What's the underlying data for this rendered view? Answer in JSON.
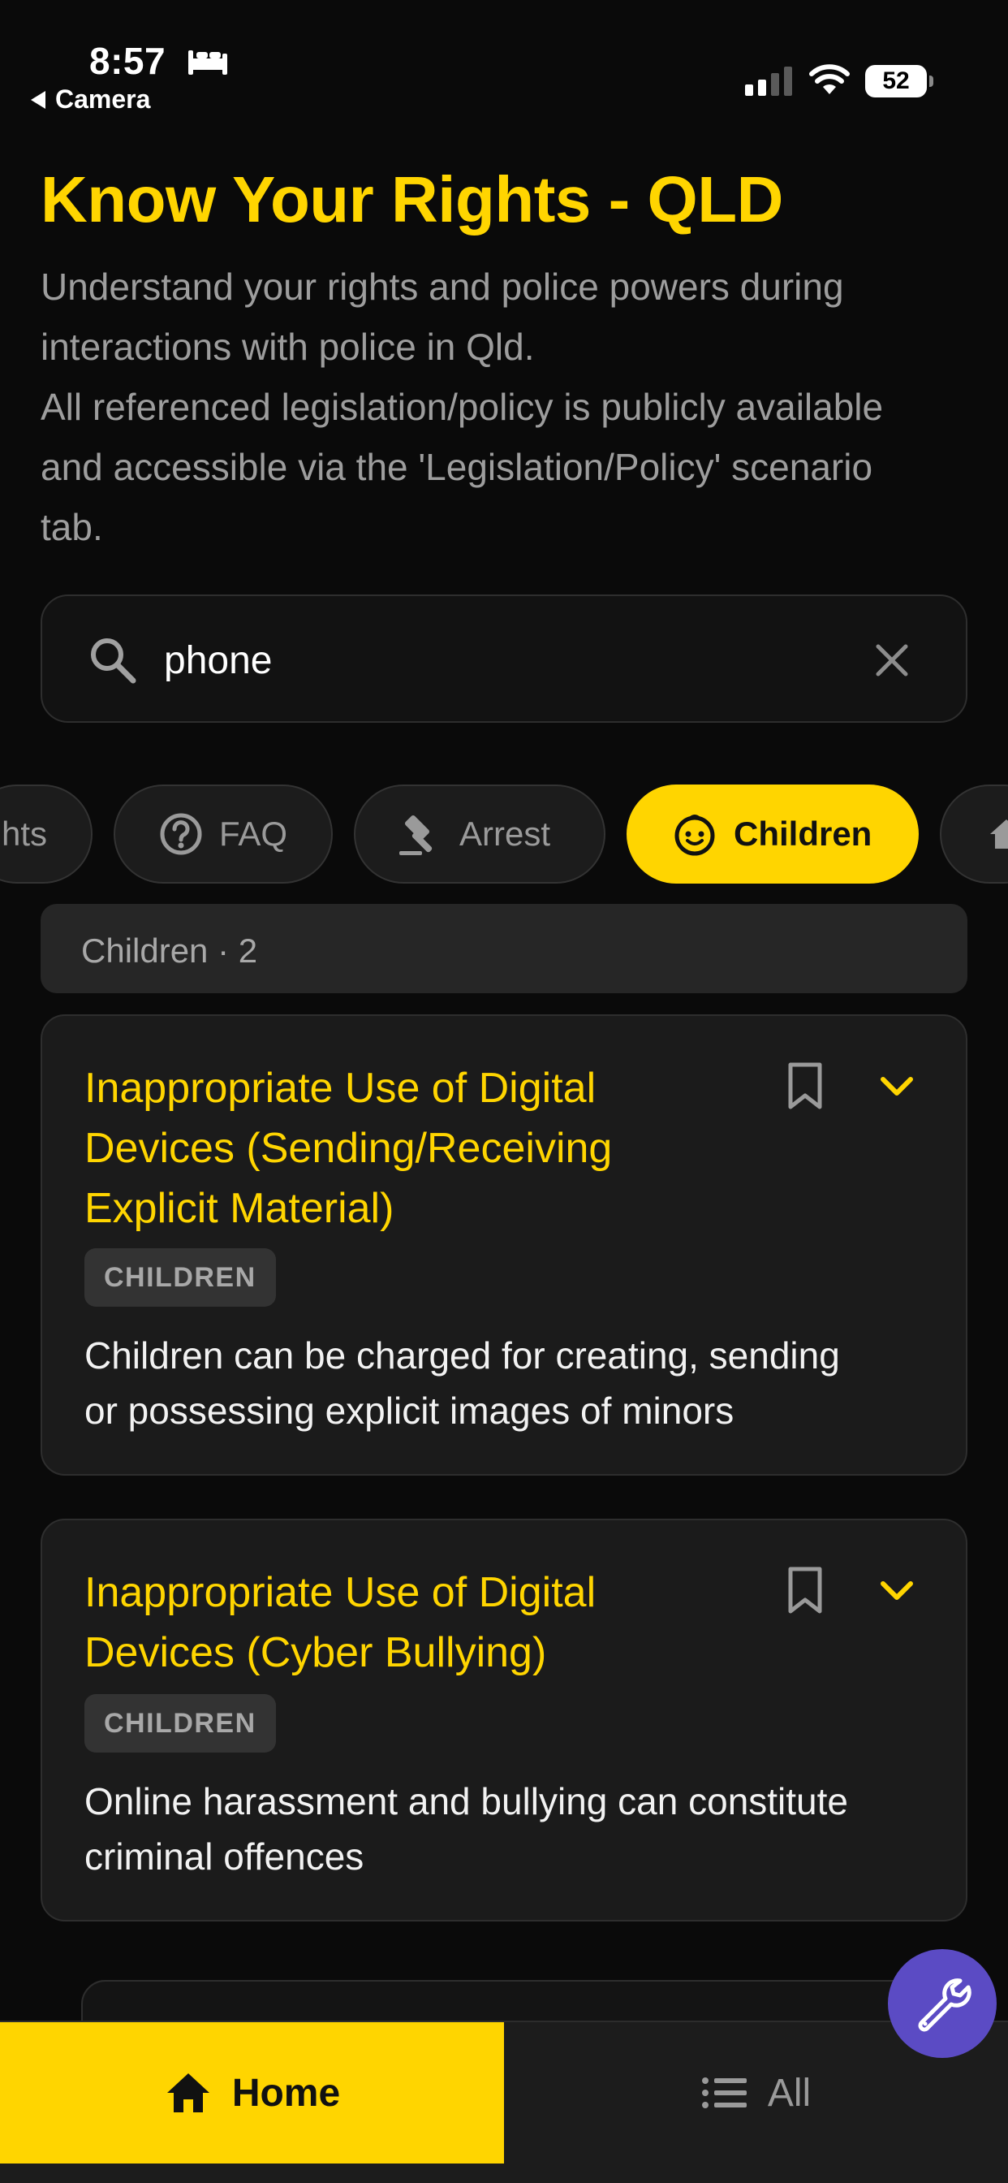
{
  "status_bar": {
    "time": "8:57",
    "back_label": "Camera",
    "battery_level": "52"
  },
  "header": {
    "title": "Know Your Rights - QLD",
    "subtitle_lines": [
      "Understand your rights and police powers during",
      "interactions with police in Qld.",
      "All referenced legislation/policy is publicly available",
      "and accessible via the 'Legislation/Policy' scenario",
      "tab."
    ]
  },
  "search": {
    "value": "phone",
    "placeholder": ""
  },
  "chips": [
    {
      "label": "hts",
      "icon": "partial-chip",
      "active": false
    },
    {
      "label": "FAQ",
      "icon": "help-circle-icon",
      "active": false
    },
    {
      "label": "Arrest",
      "icon": "gavel-icon",
      "active": false
    },
    {
      "label": "Children",
      "icon": "child-face-icon",
      "active": true
    },
    {
      "label": "",
      "icon": "home-icon",
      "active": false
    }
  ],
  "group": {
    "label": "Children · 2"
  },
  "cards": [
    {
      "title_lines": [
        "Inappropriate Use of Digital",
        "Devices (Sending/Receiving",
        "Explicit Material)"
      ],
      "tag": "CHILDREN",
      "description_lines": [
        "Children can be charged for creating, sending",
        "or possessing explicit images of minors"
      ]
    },
    {
      "title_lines": [
        "Inappropriate Use of Digital",
        "Devices (Cyber Bullying)"
      ],
      "tag": "CHILDREN",
      "description_lines": [
        "Online harassment and bullying can constitute",
        "criminal offences"
      ]
    }
  ],
  "bottom_nav": {
    "home_label": "Home",
    "all_label": "All"
  },
  "colors": {
    "accent": "#FFD500",
    "background": "#0a0a0a",
    "card": "#1b1b1b",
    "fab": "#5b4bc4"
  }
}
